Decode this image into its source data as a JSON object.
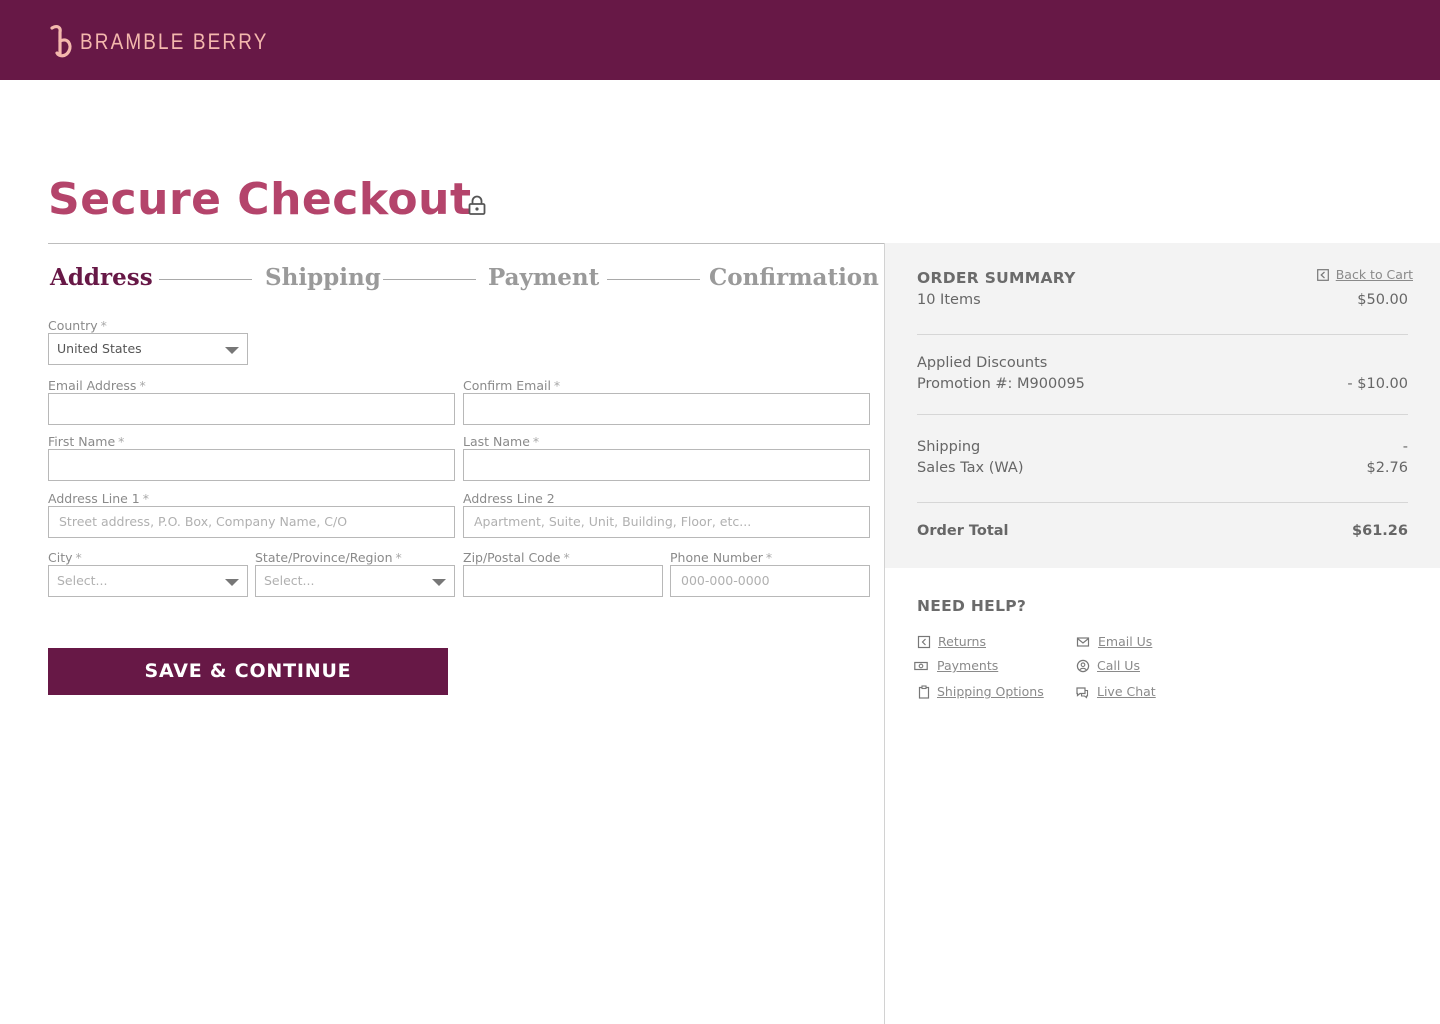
{
  "brand": {
    "name": "BRAMBLE BERRY",
    "color": "#671846",
    "accent": "#b4446b",
    "logo_color": "#f4b8ad"
  },
  "page": {
    "title": "Secure Checkout"
  },
  "steps": [
    {
      "label": "Address",
      "active": true
    },
    {
      "label": "Shipping",
      "active": false
    },
    {
      "label": "Payment",
      "active": false
    },
    {
      "label": "Confirmation",
      "active": false
    }
  ],
  "form": {
    "required_mark": "*",
    "country": {
      "label": "Country",
      "value": "United States"
    },
    "email": {
      "label": "Email Address",
      "value": ""
    },
    "confirm_email": {
      "label": "Confirm Email",
      "value": ""
    },
    "first_name": {
      "label": "First Name",
      "value": ""
    },
    "last_name": {
      "label": "Last Name",
      "value": ""
    },
    "address1": {
      "label": "Address Line 1",
      "placeholder": "Street address, P.O. Box, Company Name, C/O"
    },
    "address2": {
      "label": "Address Line 2",
      "placeholder": "Apartment, Suite, Unit, Building, Floor, etc..."
    },
    "city": {
      "label": "City",
      "placeholder": "Select..."
    },
    "state": {
      "label": "State/Province/Region",
      "placeholder": "Select..."
    },
    "zip": {
      "label": "Zip/Postal Code",
      "value": ""
    },
    "phone": {
      "label": "Phone Number",
      "placeholder": "000-000-0000"
    },
    "submit_label": "SAVE & CONTINUE"
  },
  "summary": {
    "title": "ORDER SUMMARY",
    "back_to_cart": "Back to Cart",
    "items_label": "10 Items",
    "items_value": "$50.00",
    "discounts_label": "Applied Discounts",
    "promotion_label": "Promotion #: M900095",
    "promotion_value": "- $10.00",
    "shipping_label": "Shipping",
    "shipping_value": "-",
    "tax_label": "Sales Tax (WA)",
    "tax_value": "$2.76",
    "total_label": "Order Total",
    "total_value": "$61.26"
  },
  "help": {
    "title": "NEED HELP?",
    "links": [
      {
        "label": "Returns",
        "icon": "returns-icon"
      },
      {
        "label": "Email Us",
        "icon": "envelope-icon"
      },
      {
        "label": "Payments",
        "icon": "cash-icon"
      },
      {
        "label": "Call Us",
        "icon": "phone-icon"
      },
      {
        "label": "Shipping Options",
        "icon": "clipboard-icon"
      },
      {
        "label": "Live Chat",
        "icon": "chat-icon"
      }
    ]
  }
}
